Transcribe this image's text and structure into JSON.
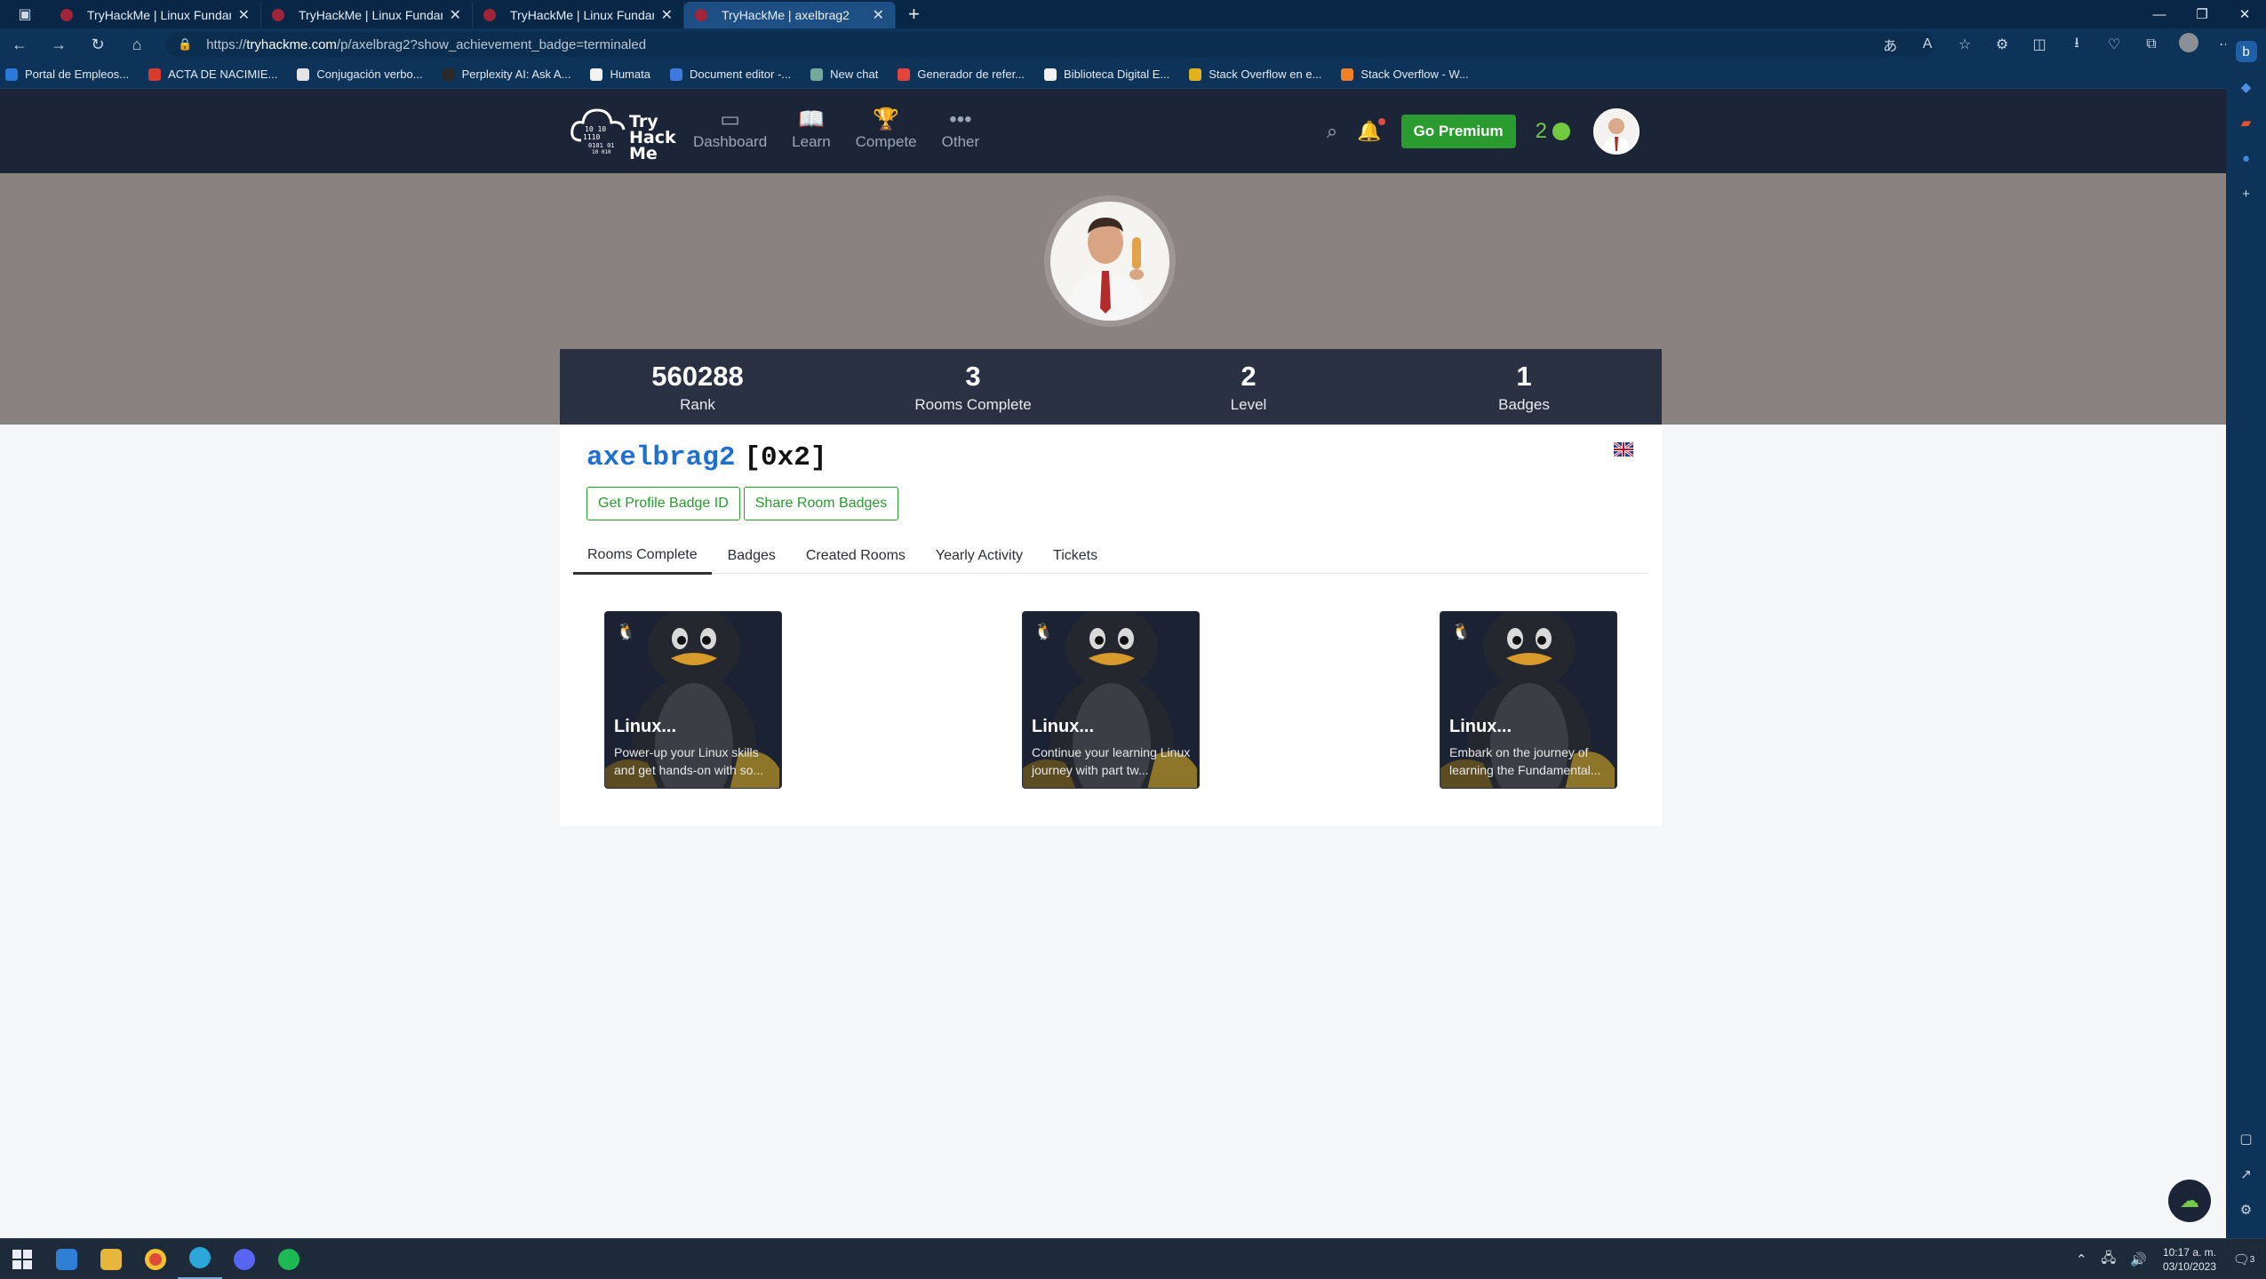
{
  "browser": {
    "tabs": [
      {
        "label": "TryHackMe | Linux Fundamentals"
      },
      {
        "label": "TryHackMe | Linux Fundamentals"
      },
      {
        "label": "TryHackMe | Linux Fundamentals"
      },
      {
        "label": "TryHackMe | axelbrag2"
      }
    ],
    "url_prefix": "https://",
    "url_domain": "tryhackme.com",
    "url_path": "/p/axelbrag2?show_achievement_badge=terminaled",
    "bookmarks": [
      {
        "label": "Portal de Empleos...",
        "color": "#2b78d6"
      },
      {
        "label": "ACTA DE NACIMIE...",
        "color": "#d93a2b"
      },
      {
        "label": "Conjugación verbo...",
        "color": "#e4e4e4"
      },
      {
        "label": "Perplexity AI: Ask A...",
        "color": "#2a2a2a"
      },
      {
        "label": "Humata",
        "color": "#f2f2f2"
      },
      {
        "label": "Document editor -...",
        "color": "#3d7be0"
      },
      {
        "label": "New chat",
        "color": "#74aa9c"
      },
      {
        "label": "Generador de refer...",
        "color": "#e5443a"
      },
      {
        "label": "Biblioteca Digital E...",
        "color": "#f0f0f0"
      },
      {
        "label": "Stack Overflow en e...",
        "color": "#e2b21e"
      },
      {
        "label": "Stack Overflow - W...",
        "color": "#f48024"
      }
    ]
  },
  "nav": {
    "logo_lines": [
      "Try",
      "Hack",
      "Me"
    ],
    "links": [
      {
        "label": "Dashboard",
        "icon": "dashboard-icon"
      },
      {
        "label": "Learn",
        "icon": "book-icon"
      },
      {
        "label": "Compete",
        "icon": "trophy-icon"
      },
      {
        "label": "Other",
        "icon": "more-icon"
      }
    ],
    "premium_label": "Go Premium",
    "streak": "2",
    "accent": "#2a9b2f"
  },
  "profile": {
    "stats": [
      {
        "value": "560288",
        "label": "Rank"
      },
      {
        "value": "3",
        "label": "Rooms Complete"
      },
      {
        "value": "2",
        "label": "Level"
      },
      {
        "value": "1",
        "label": "Badges"
      }
    ],
    "username": "axelbrag2",
    "level_tag": "[0x2]",
    "buttons": {
      "badge_id": "Get Profile Badge ID",
      "share": "Share Room Badges"
    },
    "tabs": [
      "Rooms Complete",
      "Badges",
      "Created Rooms",
      "Yearly Activity",
      "Tickets"
    ],
    "active_tab": "Rooms Complete",
    "rooms": [
      {
        "title": "Linux...",
        "description": "Power-up your Linux skills and get hands-on with so..."
      },
      {
        "title": "Linux...",
        "description": "Continue your learning Linux journey with part tw..."
      },
      {
        "title": "Linux...",
        "description": "Embark on the journey of learning the Fundamental..."
      }
    ]
  },
  "taskbar": {
    "time": "10:17 a. m.",
    "date": "03/10/2023",
    "notification_count": "3"
  }
}
